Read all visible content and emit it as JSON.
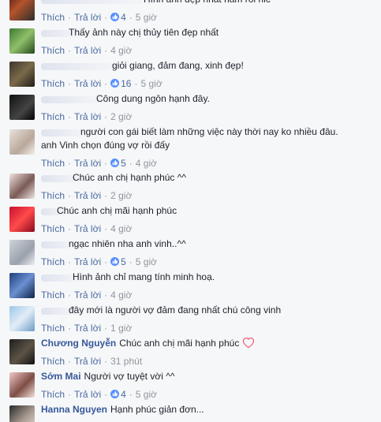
{
  "actions": {
    "like": "Thích",
    "reply": "Trả lời"
  },
  "comments": [
    {
      "author": "",
      "lines": [
        "Hình ảnh đẹp nhất năm rồi hic"
      ],
      "likes": "4",
      "time": "5 giờ",
      "avatar": "crowd-photo"
    },
    {
      "author": "",
      "lines": [
        "Thấy ảnh này chị thủy tiên đẹp nhất"
      ],
      "likes": "",
      "time": "4 giờ",
      "avatar": "green-photo"
    },
    {
      "author": "",
      "lines": [
        "giỏi giang, đảm đang, xinh đẹp!"
      ],
      "likes": "16",
      "time": "5 giờ",
      "avatar": "dark-photo"
    },
    {
      "author": "",
      "lines": [
        "Công dung ngôn hạnh đây."
      ],
      "likes": "",
      "time": "2 giờ",
      "avatar": "black-photo"
    },
    {
      "author": "",
      "lines": [
        "người con gái biết làm những việc này thời nay ko nhiều đâu.",
        "anh Vinh chọn đúng vợ rồi đấy"
      ],
      "likes": "5",
      "time": "4 giờ",
      "avatar": "face-photo"
    },
    {
      "author": "",
      "lines": [
        "Chúc anh chị hạnh phúc ^^"
      ],
      "likes": "",
      "time": "2 giờ",
      "avatar": "girl-photo"
    },
    {
      "author": "",
      "lines": [
        "Chúc anh chị mãi hạnh phúc"
      ],
      "likes": "",
      "time": "4 giờ",
      "avatar": "red-photo"
    },
    {
      "author": "",
      "lines": [
        "ngạc nhiên nha anh vinh..^^"
      ],
      "likes": "5",
      "time": "5 giờ",
      "avatar": "grey-photo"
    },
    {
      "author": "",
      "lines": [
        "Hình ảnh chỉ mang tính minh hoạ."
      ],
      "likes": "",
      "time": "4 giờ",
      "avatar": "blue-photo"
    },
    {
      "author": "",
      "lines": [
        "đây mới là người vợ đảm đang nhất chú công vinh"
      ],
      "likes": "",
      "time": "1 giờ",
      "avatar": "sky-photo"
    },
    {
      "author": "Chương Nguyễn",
      "lines": [
        "Chúc anh chị mãi hạnh phúc"
      ],
      "likes": "",
      "time": "31 phút",
      "avatar": "man-photo",
      "heart": true
    },
    {
      "author": "Sớm Mai",
      "lines": [
        "Người vợ tuyệt vời ^^"
      ],
      "likes": "4",
      "time": "5 giờ",
      "avatar": "woman-photo"
    },
    {
      "author": "Hanna Nguyen",
      "lines": [
        "Hạnh phúc giản đơn..."
      ],
      "likes": "",
      "time": "",
      "avatar": "couple-photo"
    }
  ],
  "colors": {
    "link": "#365899",
    "meta": "#90949c",
    "like_blue": "#4b6aa0",
    "heart": "#f25268"
  }
}
